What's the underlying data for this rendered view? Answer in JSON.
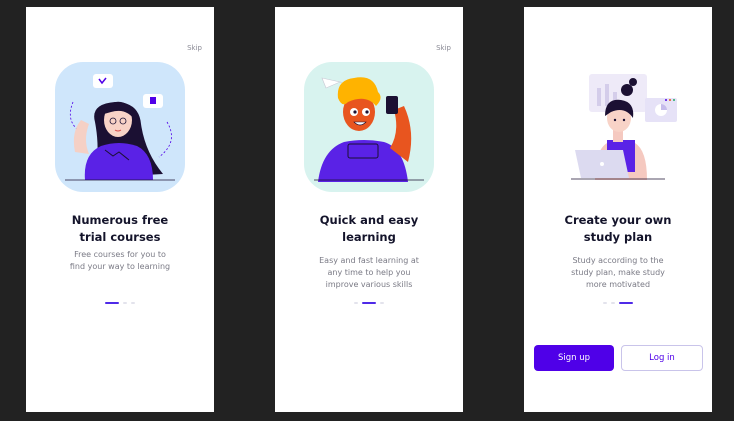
{
  "screens": [
    {
      "skip_label": "Skip",
      "title": "Numerous free\ntrial courses",
      "subtitle": "Free courses for you to\nfind your way to learning",
      "active_dot": 0
    },
    {
      "skip_label": "Skip",
      "title": "Quick and easy\nlearning",
      "subtitle": "Easy and fast learning at\nany time to help you\nimprove various skills",
      "active_dot": 1
    },
    {
      "title": "Create your own\nstudy plan",
      "subtitle": "Study according to the\nstudy plan, make study\nmore motivated",
      "active_dot": 2,
      "signup_label": "Sign up",
      "login_label": "Log in"
    }
  ],
  "colors": {
    "accent": "#4f00e8",
    "background": "#222222",
    "title": "#14142b",
    "illus_blue_bg": "#cfe6fb",
    "illus_mint_bg": "#d8f3ef"
  }
}
